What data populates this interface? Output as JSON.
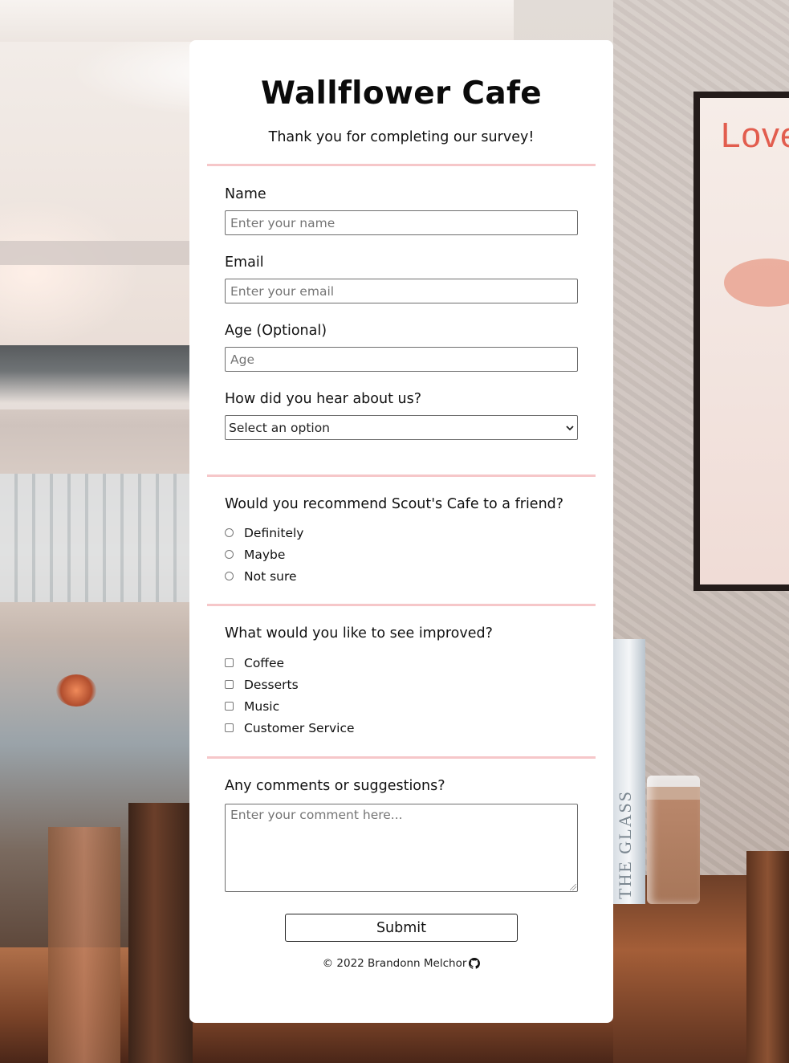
{
  "background": {
    "poster_text": "Love",
    "book_title": "THE GLASS"
  },
  "header": {
    "title": "Wallflower Cafe",
    "subtitle": "Thank you for completing our survey!"
  },
  "fields": {
    "name": {
      "label": "Name",
      "placeholder": "Enter your name"
    },
    "email": {
      "label": "Email",
      "placeholder": "Enter your email"
    },
    "age": {
      "label": "Age (Optional)",
      "placeholder": "Age"
    },
    "source": {
      "label": "How did you hear about us?",
      "selected": "Select an option"
    }
  },
  "recommend": {
    "question": "Would you recommend Scout's Cafe to a friend?",
    "options": [
      "Definitely",
      "Maybe",
      "Not sure"
    ]
  },
  "improve": {
    "question": "What would you like to see improved?",
    "options": [
      "Coffee",
      "Desserts",
      "Music",
      "Customer Service"
    ]
  },
  "comments": {
    "question": "Any comments or suggestions?",
    "placeholder": "Enter your comment here..."
  },
  "submit_label": "Submit",
  "footer": {
    "text": "© 2022 Brandonn Melchor",
    "icon": "github-icon"
  },
  "colors": {
    "divider": "#f6c7c9",
    "card": "#ffffff"
  }
}
